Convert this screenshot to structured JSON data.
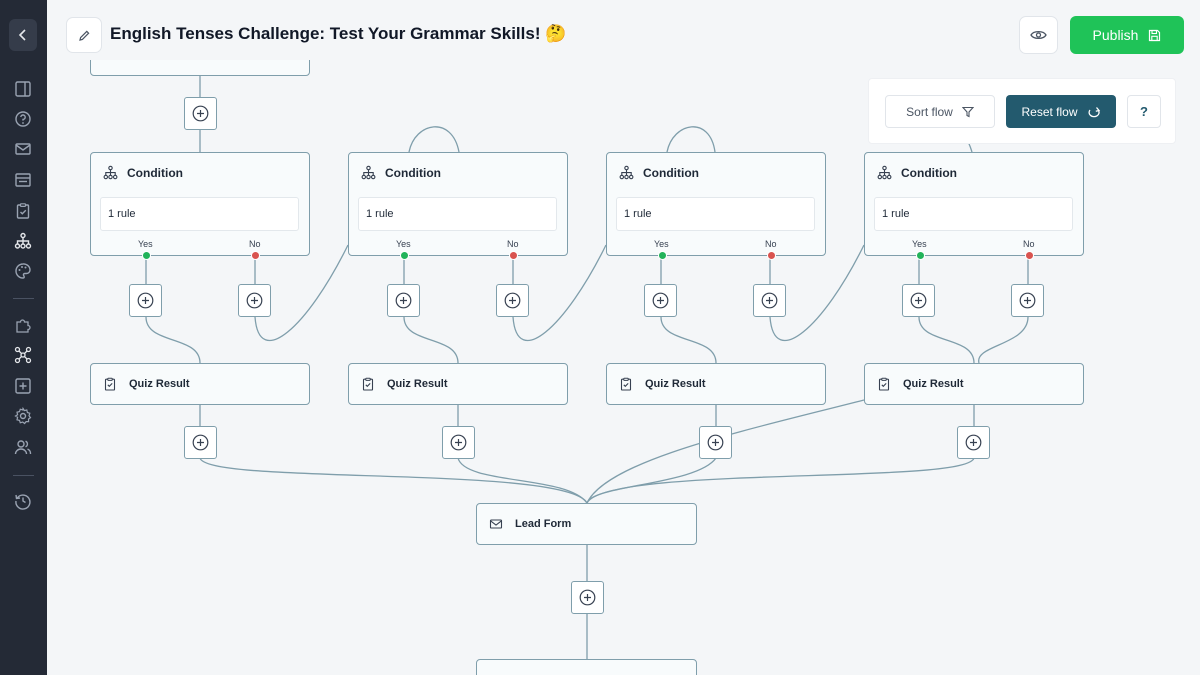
{
  "header": {
    "title": "English Tenses Challenge: Test Your Grammar Skills! 🤔",
    "publish_label": "Publish"
  },
  "sidebar": {
    "items": [
      "back-icon",
      "layout-icon",
      "help-icon",
      "mail-icon",
      "form-icon",
      "clipboard-icon",
      "flow-icon",
      "palette-icon",
      "puzzle-icon",
      "share-icon",
      "add-square-icon",
      "gear-icon",
      "users-icon",
      "history-icon"
    ]
  },
  "toolbar": {
    "sort_label": "Sort flow",
    "reset_label": "Reset flow",
    "help_label": "?"
  },
  "flow": {
    "conditions": [
      {
        "title": "Condition",
        "rule": "1 rule",
        "yes": "Yes",
        "no": "No"
      },
      {
        "title": "Condition",
        "rule": "1 rule",
        "yes": "Yes",
        "no": "No"
      },
      {
        "title": "Condition",
        "rule": "1 rule",
        "yes": "Yes",
        "no": "No"
      },
      {
        "title": "Condition",
        "rule": "1 rule",
        "yes": "Yes",
        "no": "No"
      }
    ],
    "results": [
      {
        "title": "Quiz Result"
      },
      {
        "title": "Quiz Result"
      },
      {
        "title": "Quiz Result"
      },
      {
        "title": "Quiz Result"
      }
    ],
    "lead_form": {
      "title": "Lead Form"
    }
  },
  "colors": {
    "sidebar_bg": "#242a36",
    "publish_green": "#1fc358",
    "reset_teal": "#235a6e",
    "edge": "#7f9eab",
    "yes_port": "#22b35a",
    "no_port": "#d9534f"
  }
}
